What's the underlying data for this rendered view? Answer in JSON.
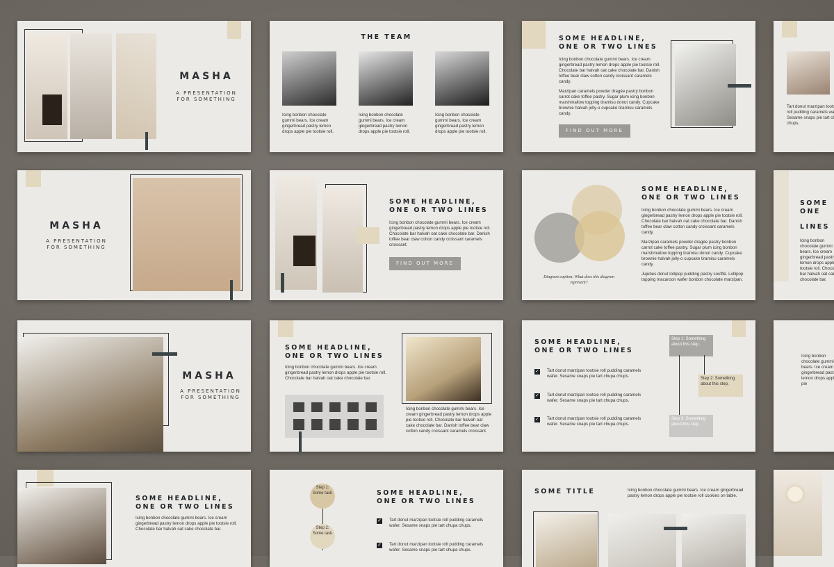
{
  "brand": "MASHA",
  "subtitle_line1": "A PRESENTATION",
  "subtitle_line2": "FOR SOMETHING",
  "team_title": "THE TEAM",
  "headline_line1": "SOME HEADLINE,",
  "headline_line2": "ONE OR TWO LINES",
  "some_title": "SOME TITLE",
  "find_out_more": "FIND OUT MORE",
  "team_texts": [
    "Icing bonbon chocolate gummi bears. Ice cream gingerbread pastry lemon drops apple pie tootsie roll.",
    "Icing bonbon chocolate gummi bears. Ice cream gingerbread pastry lemon drops apple pie tootsie roll.",
    "Icing bonbon chocolate gummi bears. Ice cream gingerbread pastry lemon drops apple pie tootsie roll."
  ],
  "para_a": "Icing bonbon chocolate gummi bears. Ice cream gingerbread pastry lemon drops apple pie tootsie roll. Chocolate bar halvah oat cake chocolate bar. Danish toffee bear claw cotton candy croissant caramels candy.",
  "para_b": "Marzipan caramels powder dragée pastry bonbon carrot cake toffee pastry. Sugar plum icing bonbon marshmallow topping tiramisu donut candy. Cupcake brownie halvah jelly-o cupcake tiramisu caramels candy.",
  "para_c": "Icing bonbon chocolate gummi bears. Ice cream gingerbread pastry lemon drops apple pie tootsie roll. Chocolate bar halvah oat cake chocolate bar. Danish toffee bear claw cotton candy croissant caramels croissant.",
  "para_d": "Jujubes donut lollipop pudding pastry soufflé. Lollipop topping macaroon wafer bonbon chocolate marzipan.",
  "para_short": "Icing bonbon chocolate gummi bears. Ice cream gingerbread pastry lemon drops apple pie tootsie roll. Chocolate bar halvah oat cake chocolate bar.",
  "para_stair": "Icing bonbon chocolate gummi bears. Ice cream gingerbread pastry lemon drops apple pie tootsie roll. Chocolate bar halvah oat cake chocolate bar. Danish toffee bear claw cotton candy croissant caramels croissant.",
  "para_title": "Icing bonbon chocolate gummi bears. Ice cream gingerbread pastry lemon drops apple pie tootsie roll cookies on table.",
  "diagram_caption": "Diagram caption: What does this diagram represent?",
  "check_item": "Tart donut marzipan tootsie roll pudding caramels wafer. Sesame snaps pie tart chupa chups.",
  "step1": "Step 1: Something about this step.",
  "step2": "Step 2: Something about this step.",
  "step3": "Step 3: Something about this step.",
  "circle_step1": "Step 1: Some task",
  "circle_step2": "Step 2: Some task",
  "edge_text_a": "Tart donut marzipan tootsie roll pudding caramels wafer. Sesame snaps pie tart chupa chups.",
  "edge_text_b": "Icing bonbon chocolate gummi bears. Ice cream gingerbread pastry lemon drops apple pie tootsie roll. Chocolate bar halvah oat cake chocolate bar.",
  "edge_text_c": "Icing bonbon chocolate gummi bears. Ice cream gingerbread pastry lemon drops apple pie",
  "edge_title_a": "SOME",
  "edge_title_b": "ONE",
  "edge_title_c": "LINES",
  "colors": {
    "beige": "#e2d7bf",
    "accent_dark": "#3b4547",
    "button": "#9b9996",
    "slide_bg": "#ebeae7",
    "backdrop": "#6f6a64"
  },
  "icons": [
    "checkbox-icon"
  ]
}
